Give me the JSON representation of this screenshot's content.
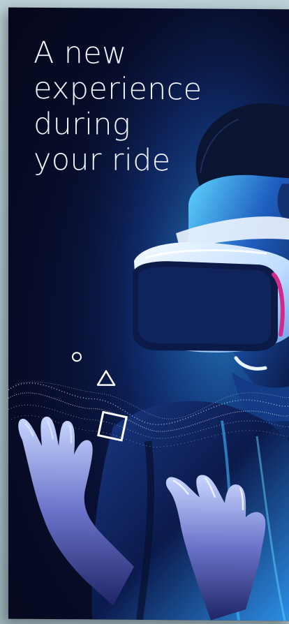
{
  "poster": {
    "headline_lines": [
      "A new",
      "experience",
      "during",
      "your ride"
    ]
  },
  "colors": {
    "background": "#05081c",
    "accent_glow": "#2fb6ff",
    "headset_white": "#e9f2ff",
    "lens_magenta": "#d22a8a"
  },
  "icons": [
    "circle-shape-icon",
    "triangle-shape-icon",
    "square-shape-icon"
  ]
}
